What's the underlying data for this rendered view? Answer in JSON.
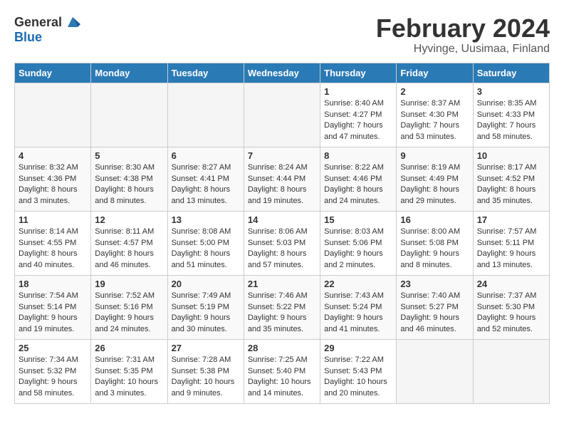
{
  "logo": {
    "general": "General",
    "blue": "Blue"
  },
  "title": {
    "month": "February 2024",
    "location": "Hyvinge, Uusimaa, Finland"
  },
  "headers": [
    "Sunday",
    "Monday",
    "Tuesday",
    "Wednesday",
    "Thursday",
    "Friday",
    "Saturday"
  ],
  "weeks": [
    [
      {
        "day": "",
        "info": ""
      },
      {
        "day": "",
        "info": ""
      },
      {
        "day": "",
        "info": ""
      },
      {
        "day": "",
        "info": ""
      },
      {
        "day": "1",
        "info": "Sunrise: 8:40 AM\nSunset: 4:27 PM\nDaylight: 7 hours\nand 47 minutes."
      },
      {
        "day": "2",
        "info": "Sunrise: 8:37 AM\nSunset: 4:30 PM\nDaylight: 7 hours\nand 53 minutes."
      },
      {
        "day": "3",
        "info": "Sunrise: 8:35 AM\nSunset: 4:33 PM\nDaylight: 7 hours\nand 58 minutes."
      }
    ],
    [
      {
        "day": "4",
        "info": "Sunrise: 8:32 AM\nSunset: 4:36 PM\nDaylight: 8 hours\nand 3 minutes."
      },
      {
        "day": "5",
        "info": "Sunrise: 8:30 AM\nSunset: 4:38 PM\nDaylight: 8 hours\nand 8 minutes."
      },
      {
        "day": "6",
        "info": "Sunrise: 8:27 AM\nSunset: 4:41 PM\nDaylight: 8 hours\nand 13 minutes."
      },
      {
        "day": "7",
        "info": "Sunrise: 8:24 AM\nSunset: 4:44 PM\nDaylight: 8 hours\nand 19 minutes."
      },
      {
        "day": "8",
        "info": "Sunrise: 8:22 AM\nSunset: 4:46 PM\nDaylight: 8 hours\nand 24 minutes."
      },
      {
        "day": "9",
        "info": "Sunrise: 8:19 AM\nSunset: 4:49 PM\nDaylight: 8 hours\nand 29 minutes."
      },
      {
        "day": "10",
        "info": "Sunrise: 8:17 AM\nSunset: 4:52 PM\nDaylight: 8 hours\nand 35 minutes."
      }
    ],
    [
      {
        "day": "11",
        "info": "Sunrise: 8:14 AM\nSunset: 4:55 PM\nDaylight: 8 hours\nand 40 minutes."
      },
      {
        "day": "12",
        "info": "Sunrise: 8:11 AM\nSunset: 4:57 PM\nDaylight: 8 hours\nand 46 minutes."
      },
      {
        "day": "13",
        "info": "Sunrise: 8:08 AM\nSunset: 5:00 PM\nDaylight: 8 hours\nand 51 minutes."
      },
      {
        "day": "14",
        "info": "Sunrise: 8:06 AM\nSunset: 5:03 PM\nDaylight: 8 hours\nand 57 minutes."
      },
      {
        "day": "15",
        "info": "Sunrise: 8:03 AM\nSunset: 5:06 PM\nDaylight: 9 hours\nand 2 minutes."
      },
      {
        "day": "16",
        "info": "Sunrise: 8:00 AM\nSunset: 5:08 PM\nDaylight: 9 hours\nand 8 minutes."
      },
      {
        "day": "17",
        "info": "Sunrise: 7:57 AM\nSunset: 5:11 PM\nDaylight: 9 hours\nand 13 minutes."
      }
    ],
    [
      {
        "day": "18",
        "info": "Sunrise: 7:54 AM\nSunset: 5:14 PM\nDaylight: 9 hours\nand 19 minutes."
      },
      {
        "day": "19",
        "info": "Sunrise: 7:52 AM\nSunset: 5:16 PM\nDaylight: 9 hours\nand 24 minutes."
      },
      {
        "day": "20",
        "info": "Sunrise: 7:49 AM\nSunset: 5:19 PM\nDaylight: 9 hours\nand 30 minutes."
      },
      {
        "day": "21",
        "info": "Sunrise: 7:46 AM\nSunset: 5:22 PM\nDaylight: 9 hours\nand 35 minutes."
      },
      {
        "day": "22",
        "info": "Sunrise: 7:43 AM\nSunset: 5:24 PM\nDaylight: 9 hours\nand 41 minutes."
      },
      {
        "day": "23",
        "info": "Sunrise: 7:40 AM\nSunset: 5:27 PM\nDaylight: 9 hours\nand 46 minutes."
      },
      {
        "day": "24",
        "info": "Sunrise: 7:37 AM\nSunset: 5:30 PM\nDaylight: 9 hours\nand 52 minutes."
      }
    ],
    [
      {
        "day": "25",
        "info": "Sunrise: 7:34 AM\nSunset: 5:32 PM\nDaylight: 9 hours\nand 58 minutes."
      },
      {
        "day": "26",
        "info": "Sunrise: 7:31 AM\nSunset: 5:35 PM\nDaylight: 10 hours\nand 3 minutes."
      },
      {
        "day": "27",
        "info": "Sunrise: 7:28 AM\nSunset: 5:38 PM\nDaylight: 10 hours\nand 9 minutes."
      },
      {
        "day": "28",
        "info": "Sunrise: 7:25 AM\nSunset: 5:40 PM\nDaylight: 10 hours\nand 14 minutes."
      },
      {
        "day": "29",
        "info": "Sunrise: 7:22 AM\nSunset: 5:43 PM\nDaylight: 10 hours\nand 20 minutes."
      },
      {
        "day": "",
        "info": ""
      },
      {
        "day": "",
        "info": ""
      }
    ]
  ]
}
